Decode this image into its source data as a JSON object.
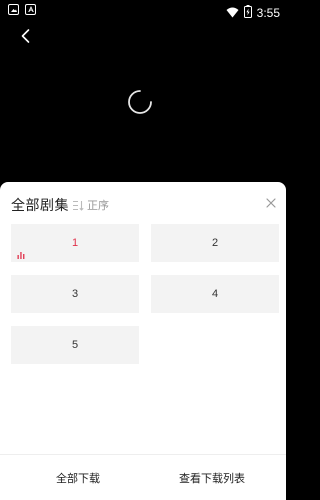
{
  "status_bar": {
    "time": "3:55",
    "left_icons": [
      "image-notification-icon",
      "text-notification-icon"
    ],
    "right_icons": [
      "wifi-icon",
      "battery-icon"
    ]
  },
  "player": {
    "back_icon": "chevron-left-icon",
    "loading_icon": "loading-spinner-icon"
  },
  "panel": {
    "title": "全部剧集",
    "sort_icon": "sort-list-icon",
    "sort_label": "正序",
    "close_icon": "close-icon"
  },
  "episodes": [
    {
      "label": "1",
      "active": true
    },
    {
      "label": "2",
      "active": false
    },
    {
      "label": "3",
      "active": false
    },
    {
      "label": "4",
      "active": false
    },
    {
      "label": "5",
      "active": false
    }
  ],
  "footer": {
    "download_all": "全部下载",
    "view_downloads": "查看下载列表"
  },
  "colors": {
    "active_episode": "#e0304a",
    "tile_background": "#f3f3f3",
    "player_background": "#000000"
  }
}
